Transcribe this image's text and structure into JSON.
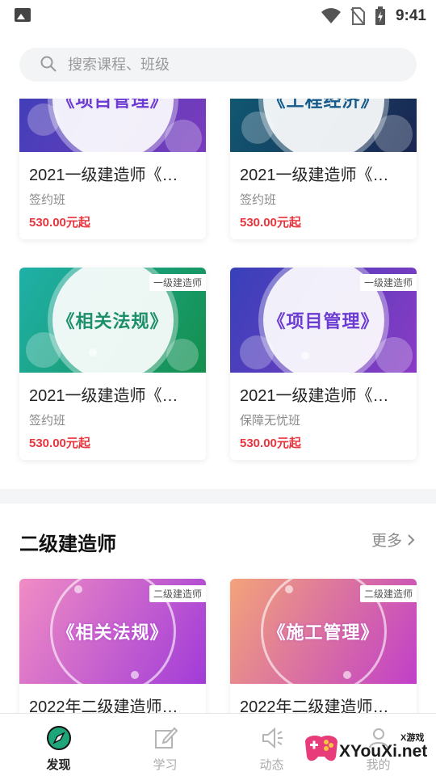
{
  "status_bar": {
    "time": "9:41"
  },
  "search": {
    "placeholder": "搜索课程、班级"
  },
  "top_cards": [
    {
      "thumb_title": "《项目管理》",
      "badge": "",
      "name": "2021一级建造师《…",
      "class_type": "签约班",
      "price": "530.00元起",
      "colors": [
        "#3b3fb8",
        "#7a3bbd"
      ]
    },
    {
      "thumb_title": "《工程经济》",
      "badge": "",
      "name": "2021一级建造师《…",
      "class_type": "签约班",
      "price": "530.00元起",
      "colors": [
        "#0f5f77",
        "#1a2550"
      ]
    },
    {
      "thumb_title": "《相关法规》",
      "badge": "一级建造师",
      "name": "2021一级建造师《…",
      "class_type": "签约班",
      "price": "530.00元起",
      "colors": [
        "#1fb0a8",
        "#148f4c"
      ]
    },
    {
      "thumb_title": "《项目管理》",
      "badge": "一级建造师",
      "name": "2021一级建造师《…",
      "class_type": "保障无忧班",
      "price": "530.00元起",
      "colors": [
        "#3740b9",
        "#8a3bc4"
      ]
    }
  ],
  "section": {
    "title": "二级建造师",
    "more_label": "更多"
  },
  "second_cards": [
    {
      "thumb_title": "《相关法规》",
      "badge": "二级建造师",
      "name": "2022年二级建造师…",
      "colors": [
        "#f08cc4",
        "#a13bd8"
      ]
    },
    {
      "thumb_title": "《施工管理》",
      "badge": "二级建造师",
      "name": "2022年二级建造师…",
      "colors": [
        "#f3a37a",
        "#c13fc9"
      ]
    }
  ],
  "bottom_nav": [
    {
      "label": "发现",
      "icon": "compass-icon",
      "active": true
    },
    {
      "label": "学习",
      "icon": "edit-icon",
      "active": false
    },
    {
      "label": "动态",
      "icon": "speaker-icon",
      "active": false
    },
    {
      "label": "我的",
      "icon": "user-icon",
      "active": false
    }
  ],
  "watermark": {
    "text": "XYouXi.net",
    "small": "X游戏"
  },
  "colors": {
    "accent_price": "#e8353d",
    "nav_active": "#1fa57a"
  }
}
